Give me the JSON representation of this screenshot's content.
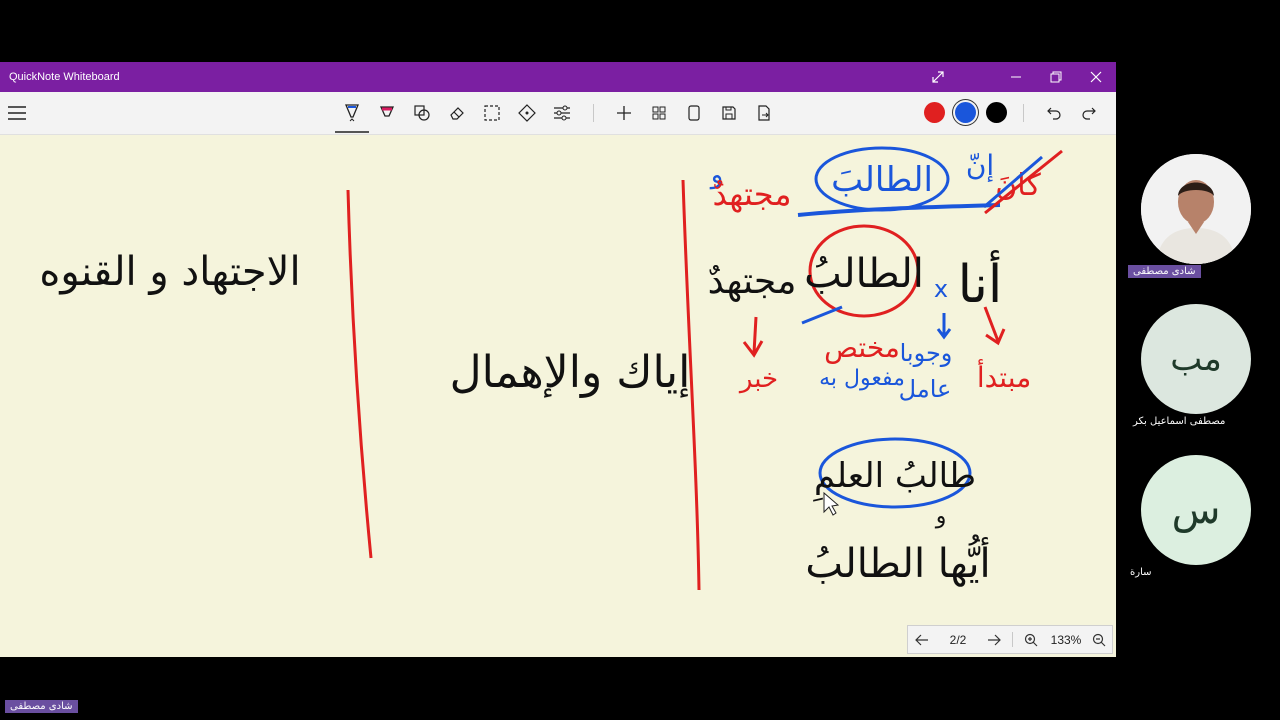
{
  "window": {
    "title": "QuickNote Whiteboard"
  },
  "toolbar": {
    "menu_icon": "hamburger-icon",
    "tools": [
      "pen-icon",
      "highlighter-icon",
      "shapes-icon",
      "eraser-icon",
      "lasso-select-icon",
      "pan-icon",
      "settings-sliders-icon"
    ],
    "page_tools": [
      "add-page-icon",
      "grid-icon",
      "page-icon",
      "save-icon",
      "export-icon"
    ],
    "colors": [
      "#e02020",
      "#1a56db",
      "#000000"
    ],
    "selected_color": "#1a56db"
  },
  "board": {
    "col1": {
      "heading": "الاجتهاد و القنوه"
    },
    "col2": {
      "phrase": "إياك والإهمال"
    },
    "col3": {
      "top_red_left": "مجتهدٌ",
      "top_blue_left": "و",
      "top_circled": "الطالبَ",
      "top_inna": "إنّ",
      "top_kana": "كانَ",
      "sentence_ana": "أنا",
      "sentence_circled": "الطالبُ",
      "sentence_mujtahid": "مجتهدٌ",
      "label_khabar": "خبر",
      "label_mukhtass": "مختص",
      "label_wujuban": "وجوبا",
      "label_mafool": "مفعول به",
      "label_amil": "عامل",
      "label_mubtada": "مبتدأ",
      "mark_x": "x",
      "bottom_circled": "طالبُ العلمِ",
      "bottom_connector": "و",
      "bottom_line": "أيُّها الطالبُ"
    }
  },
  "page_nav": {
    "page_indicator": "2/2",
    "zoom": "133%"
  },
  "participants": [
    {
      "name": "شادى مصطفى",
      "initials": "",
      "has_photo": true
    },
    {
      "name": "مصطفى اسماعيل بكر",
      "initials": "مب",
      "has_photo": false
    },
    {
      "name": "سارة",
      "initials": "س",
      "has_photo": false
    }
  ],
  "self_label": "شادى مصطفى"
}
